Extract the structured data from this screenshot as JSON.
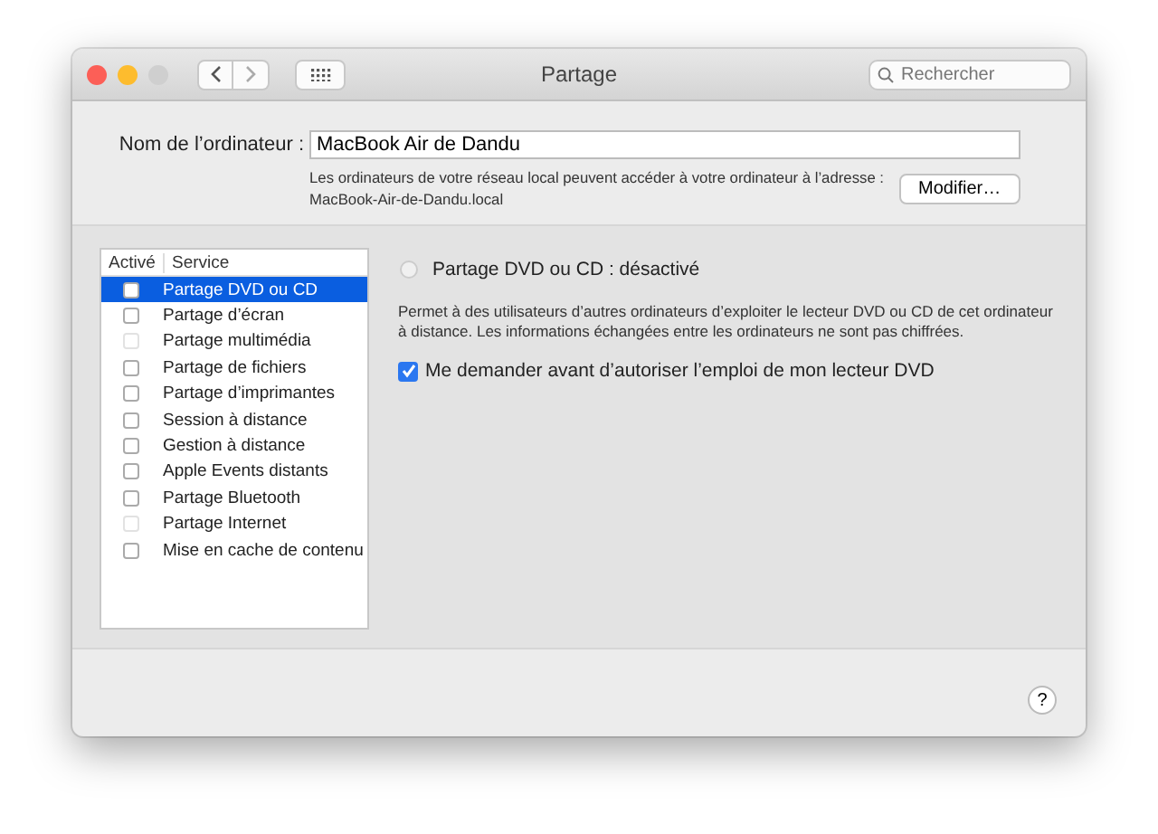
{
  "window": {
    "title": "Partage",
    "search_placeholder": "Rechercher"
  },
  "computer_name": {
    "label": "Nom de l’ordinateur :",
    "value": "MacBook Air de Dandu",
    "info": "Les ordinateurs de votre réseau local peuvent accéder à votre ordinateur à l’adresse :",
    "address": "MacBook-Air-de-Dandu.local",
    "button": "Modifier…"
  },
  "services": {
    "columns": [
      "Activé",
      "Service"
    ],
    "rows": [
      {
        "name": "Partage DVD ou CD",
        "checked": false,
        "disabled": false,
        "selected": true
      },
      {
        "name": "Partage d’écran",
        "checked": false,
        "disabled": false,
        "selected": false
      },
      {
        "name": "Partage multimédia",
        "checked": false,
        "disabled": true,
        "selected": false
      },
      {
        "name": "Partage de fichiers",
        "checked": false,
        "disabled": false,
        "selected": false
      },
      {
        "name": "Partage d’imprimantes",
        "checked": false,
        "disabled": false,
        "selected": false
      },
      {
        "name": "Session à distance",
        "checked": false,
        "disabled": false,
        "selected": false
      },
      {
        "name": "Gestion à distance",
        "checked": false,
        "disabled": false,
        "selected": false
      },
      {
        "name": "Apple Events distants",
        "checked": false,
        "disabled": false,
        "selected": false
      },
      {
        "name": "Partage Bluetooth",
        "checked": false,
        "disabled": false,
        "selected": false
      },
      {
        "name": "Partage Internet",
        "checked": false,
        "disabled": true,
        "selected": false
      },
      {
        "name": "Mise en cache de contenu",
        "checked": false,
        "disabled": false,
        "selected": false
      }
    ]
  },
  "detail": {
    "status": "Partage DVD ou CD : désactivé",
    "status_on": false,
    "description": "Permet à des utilisateurs d’autres ordinateurs d’exploiter le lecteur DVD ou CD de cet ordinateur à distance. Les informations échangées entre les ordinateurs ne sont pas chiffrées.",
    "option": {
      "label": "Me demander avant d’autoriser l’emploi de mon lecteur DVD",
      "checked": true
    }
  },
  "help_button": "?"
}
